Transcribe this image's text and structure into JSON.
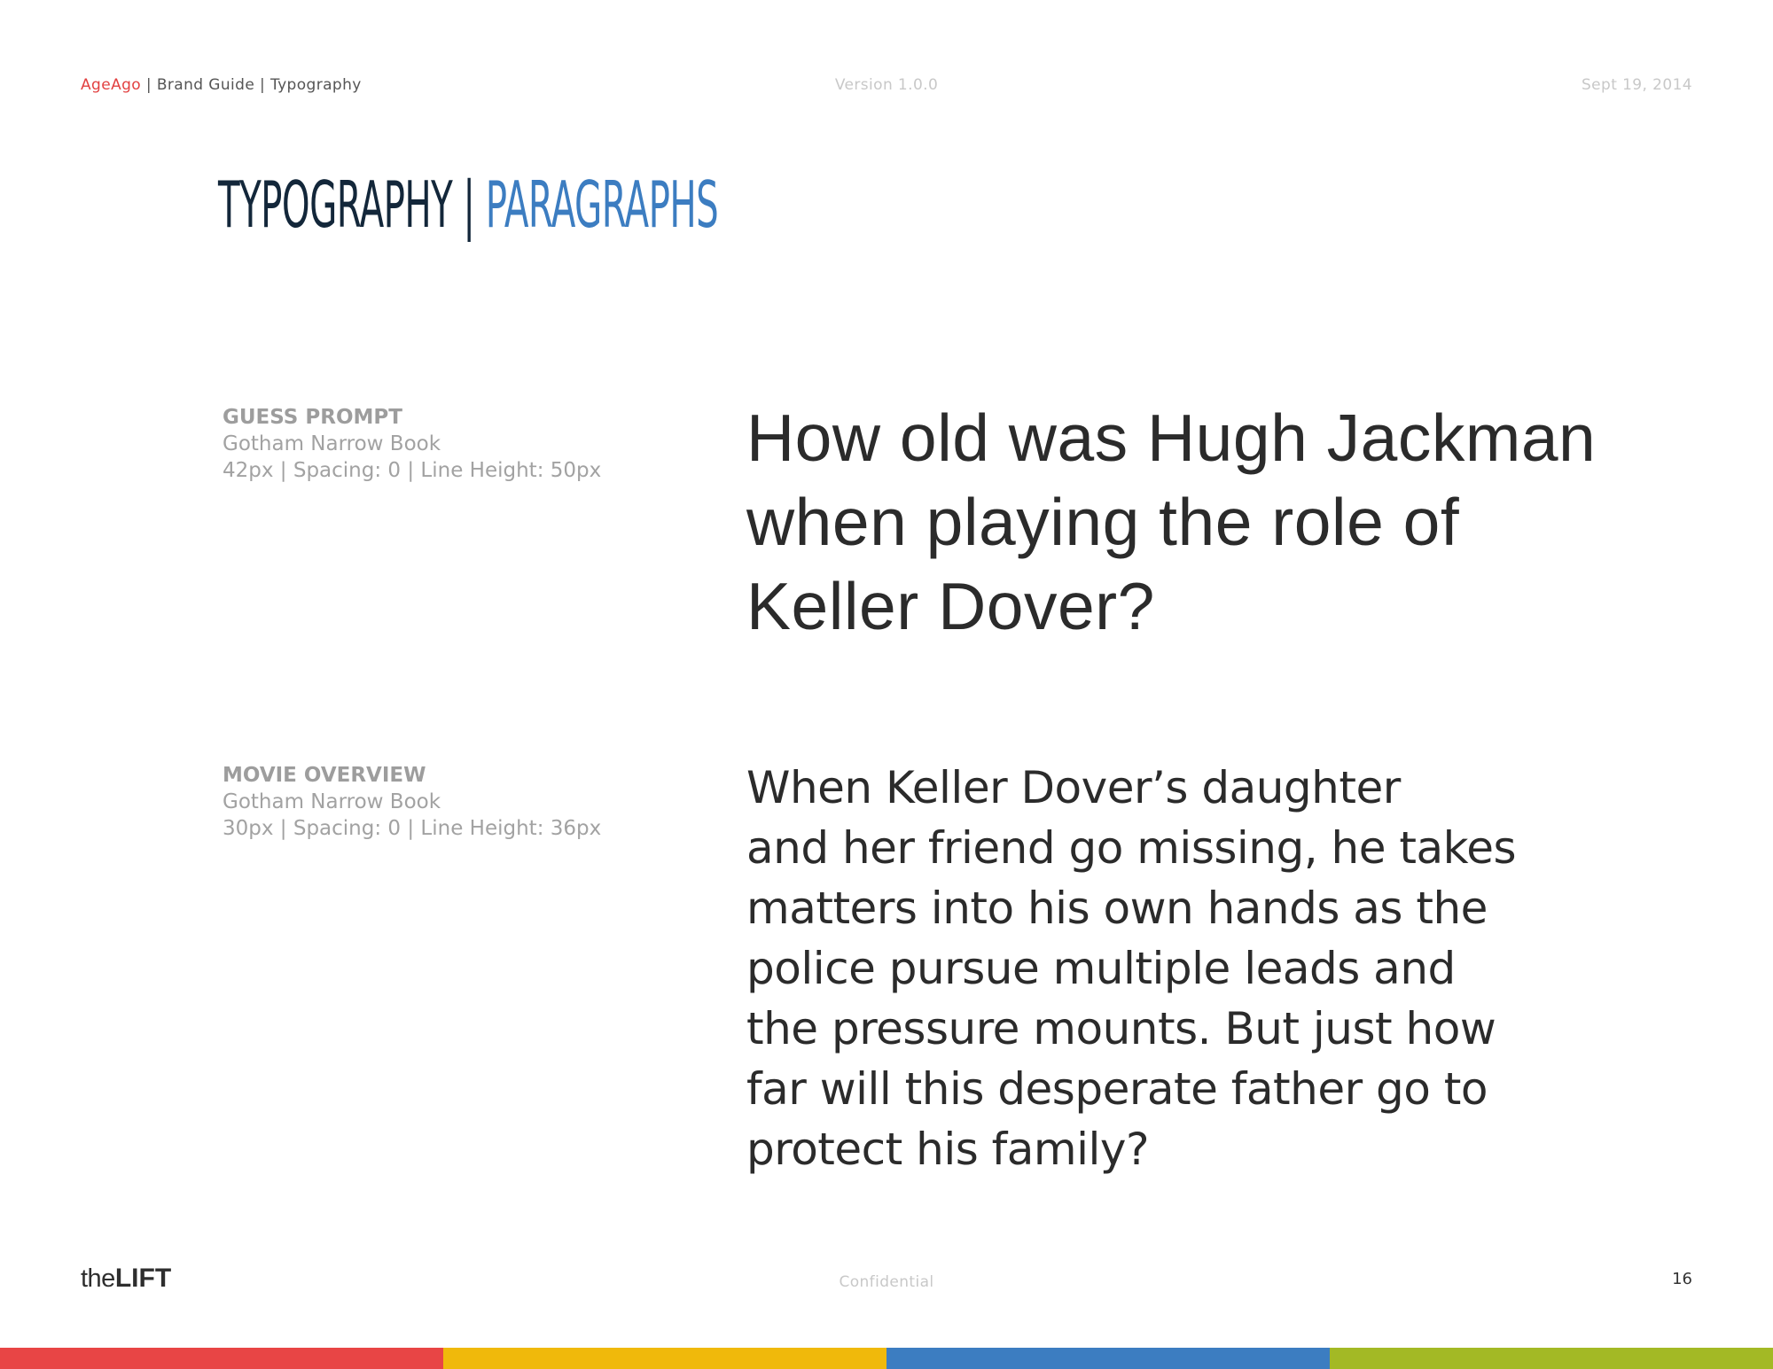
{
  "header": {
    "brand": "AgeAgo",
    "breadcrumb": " | Brand Guide | Typography",
    "version": "Version 1.0.0",
    "date": "Sept 19, 2014"
  },
  "title": {
    "part1": "TYPOGRAPHY",
    "separator": " | ",
    "part2": "PARAGRAPHS"
  },
  "specs": [
    {
      "name": "GUESS PROMPT",
      "font": "Gotham Narrow Book",
      "details": "42px | Spacing: 0 | Line Height: 50px"
    },
    {
      "name": "MOVIE OVERVIEW",
      "font": "Gotham Narrow Book",
      "details": "30px | Spacing: 0 | Line Height: 36px"
    }
  ],
  "samples": {
    "guess_prompt": [
      "How old was Hugh Jackman",
      "when playing the role of",
      "Keller Dover?"
    ],
    "movie_overview": [
      "When Keller Dover’s daughter",
      "and her friend go missing, he takes",
      "matters into his own hands as the",
      "police pursue multiple leads and",
      "the pressure mounts. But just how",
      "far will this desperate father go to",
      "protect his family?"
    ]
  },
  "footer": {
    "logo_the": "the",
    "logo_lift": "LIFT",
    "confidential": "Confidential",
    "page_number": "16"
  },
  "colors": {
    "brand_red": "#e24141",
    "title_dark": "#13273a",
    "title_blue": "#3c7dc1",
    "bar": [
      "#e84545",
      "#f0b90b",
      "#3c7dc1",
      "#a3b925"
    ]
  }
}
